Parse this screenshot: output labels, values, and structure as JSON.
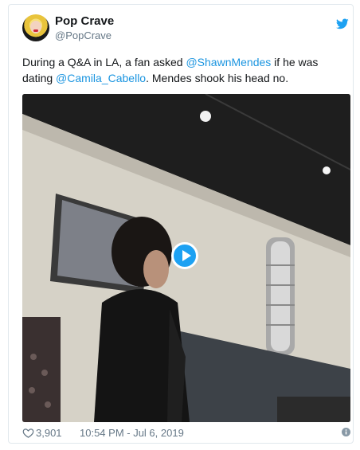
{
  "tweet": {
    "display_name": "Pop Crave",
    "handle": "@PopCrave",
    "text_1": "During a Q&A in LA, a fan asked ",
    "mention_1": "@ShawnMendes",
    "text_2": " if he was dating ",
    "mention_2": "@Camila_Cabello",
    "text_3": ". Mendes shook his head no.",
    "likes": "3,901",
    "timestamp": "10:54 PM - Jul 6, 2019"
  },
  "icons": {
    "brand": "twitter-bird-icon",
    "like": "heart-icon",
    "play": "play-icon",
    "info": "info-icon"
  },
  "colors": {
    "brand_blue": "#1da1f2",
    "link_blue": "#1b95e0",
    "muted_gray": "#657786"
  }
}
